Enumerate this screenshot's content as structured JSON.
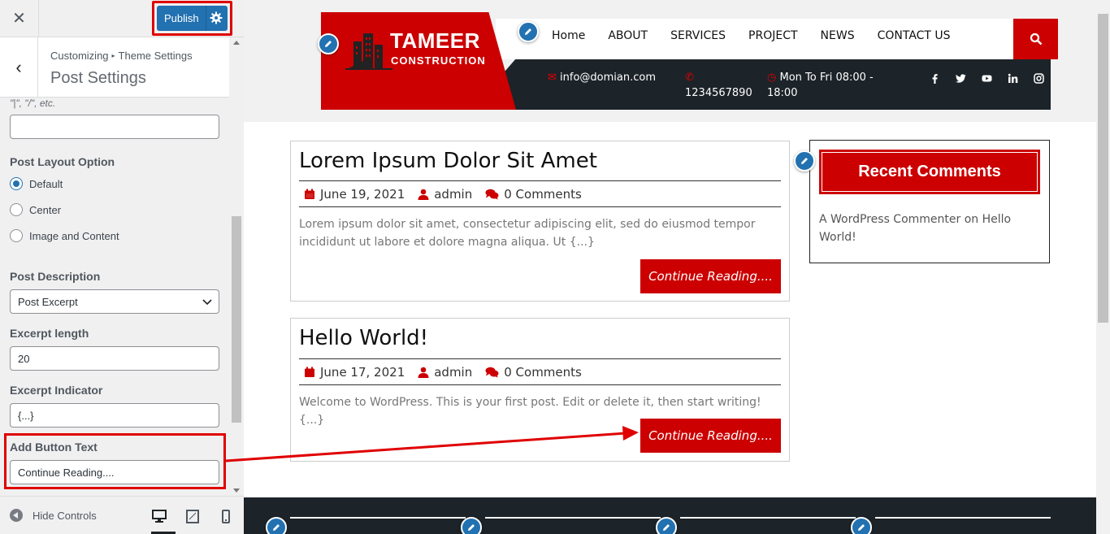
{
  "customizer": {
    "publish_label": "Publish",
    "breadcrumb_root": "Customizing",
    "breadcrumb_parent": "Theme Settings",
    "section_title": "Post Settings",
    "separator_hint": "\"|\", \"/\", etc.",
    "separator_value": "",
    "layout_label": "Post Layout Option",
    "layout_options": [
      "Default",
      "Center",
      "Image and Content"
    ],
    "layout_selected": "Default",
    "description_label": "Post Description",
    "description_value": "Post Excerpt",
    "excerpt_length_label": "Excerpt length",
    "excerpt_length_value": "20",
    "excerpt_indicator_label": "Excerpt Indicator",
    "excerpt_indicator_value": "{...}",
    "button_text_label": "Add Button Text",
    "button_text_value": "Continue Reading....",
    "hide_controls": "Hide Controls",
    "devices": [
      "desktop-icon",
      "tablet-icon",
      "mobile-icon"
    ]
  },
  "site": {
    "logo_line1": "TAMEER",
    "logo_line2": "CONSTRUCTION",
    "nav": [
      "Home",
      "ABOUT",
      "SERVICES",
      "PROJECT",
      "NEWS",
      "CONTACT US"
    ],
    "email": "info@domian.com",
    "phone": "1234567890",
    "hours_line1": "Mon To Fri 08:00 -",
    "hours_line2": "18:00",
    "socials": [
      "facebook-icon",
      "twitter-icon",
      "youtube-icon",
      "linkedin-icon",
      "instagram-icon"
    ],
    "colors": {
      "brand_red": "#cc0000",
      "dark": "#1c2329",
      "wp_blue": "#2271b1"
    }
  },
  "posts": [
    {
      "title": "Lorem Ipsum Dolor Sit Amet",
      "date": "June 19, 2021",
      "author": "admin",
      "comments": "0 Comments",
      "excerpt": "Lorem ipsum dolor sit amet, consectetur adipiscing elit, sed do eiusmod tempor incididunt ut labore et dolore magna aliqua. Ut {...}",
      "button": "Continue Reading...."
    },
    {
      "title": "Hello World!",
      "date": "June 17, 2021",
      "author": "admin",
      "comments": "0 Comments",
      "excerpt": "Welcome to WordPress. This is your first post. Edit or delete it, then start writing! {...}",
      "button": "Continue Reading...."
    }
  ],
  "sidebar_widget": {
    "title": "Recent Comments",
    "commenter": "A WordPress Commenter",
    "on": "on",
    "post_link": "Hello World!"
  }
}
